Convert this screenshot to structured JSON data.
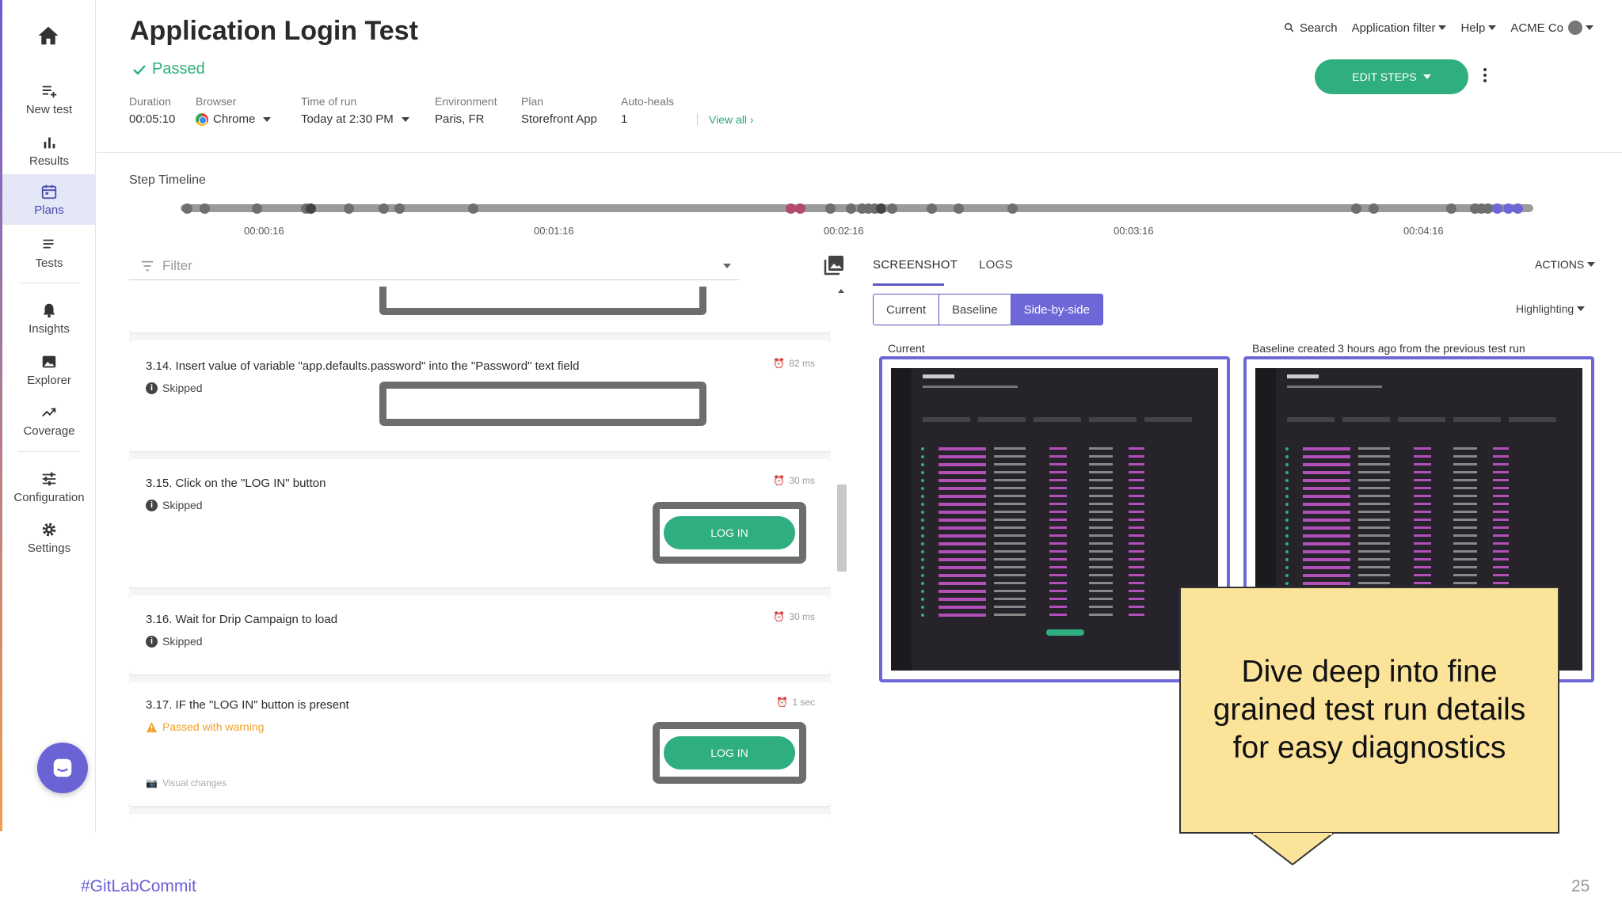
{
  "sidebar": {
    "items": [
      {
        "label": "New test",
        "icon": "add-list-icon"
      },
      {
        "label": "Results",
        "icon": "bar-chart-icon"
      },
      {
        "label": "Plans",
        "icon": "calendar-icon"
      },
      {
        "label": "Tests",
        "icon": "list-icon"
      },
      {
        "label": "Insights",
        "icon": "bell-icon"
      },
      {
        "label": "Explorer",
        "icon": "image-icon"
      },
      {
        "label": "Coverage",
        "icon": "trend-icon"
      },
      {
        "label": "Configuration",
        "icon": "sliders-icon"
      },
      {
        "label": "Settings",
        "icon": "gear-icon"
      }
    ],
    "active": "Plans"
  },
  "header": {
    "title": "Application Login Test",
    "status": "Passed",
    "meta": {
      "duration_label": "Duration",
      "duration_value": "00:05:10",
      "browser_label": "Browser",
      "browser_value": "Chrome",
      "time_label": "Time of run",
      "time_value": "Today at 2:30 PM",
      "env_label": "Environment",
      "env_value": "Paris, FR",
      "plan_label": "Plan",
      "plan_value": "Storefront App",
      "autoheals_label": "Auto-heals",
      "autoheals_value": "1"
    },
    "view_all": "View all",
    "topnav": {
      "search": "Search",
      "app_filter": "Application filter",
      "help": "Help",
      "org": "ACME Co"
    },
    "edit_steps": "EDIT STEPS"
  },
  "timeline": {
    "label": "Step Timeline",
    "ticks": [
      "00:00:16",
      "00:01:16",
      "00:02:16",
      "00:03:16",
      "00:04:16"
    ]
  },
  "steps_panel": {
    "filter_placeholder": "Filter",
    "steps": [
      {
        "title": "3.14. Insert value of variable \"app.defaults.password\" into the \"Password\" text field",
        "state": "Skipped",
        "duration": "82 ms"
      },
      {
        "title": "3.15. Click on the \"LOG IN\" button",
        "state": "Skipped",
        "duration": "30 ms",
        "button": "LOG IN"
      },
      {
        "title": "3.16. Wait for Drip Campaign to load",
        "state": "Skipped",
        "duration": "30 ms"
      },
      {
        "title": "3.17. IF the \"LOG IN\" button is present",
        "state": "Passed with warning",
        "duration": "1 sec",
        "button": "LOG IN",
        "note": "Visual changes"
      }
    ]
  },
  "right_panel": {
    "tabs": [
      "SCREENSHOT",
      "LOGS"
    ],
    "actions": "ACTIONS",
    "views": [
      "Current",
      "Baseline",
      "Side-by-side"
    ],
    "highlighting": "Highlighting",
    "current_label": "Current",
    "baseline_label": "Baseline created 3 hours ago from the previous test run"
  },
  "callout": "Dive deep into fine grained test run details for easy diagnostics",
  "footer": {
    "tag": "#GitLabCommit",
    "page": "25"
  }
}
